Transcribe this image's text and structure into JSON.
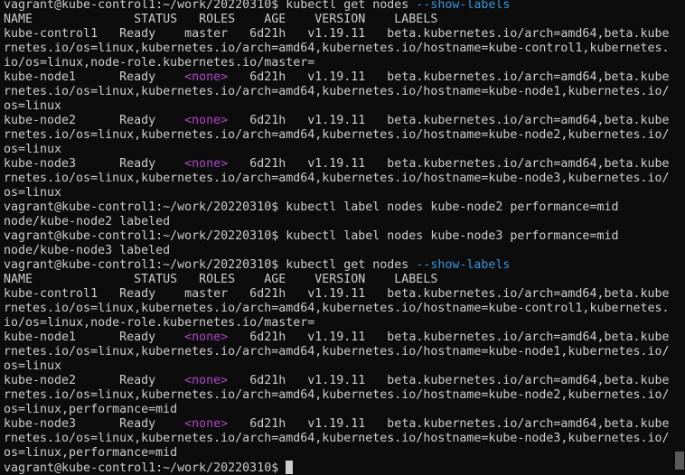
{
  "terminal": {
    "lines": [
      [
        {
          "t": "vagrant@kube-control1:~/work/20220310$ kubectl get nodes "
        },
        {
          "t": "--show-labels",
          "c": "flag"
        }
      ],
      [
        {
          "t": "NAME              STATUS   ROLES    AGE    VERSION    LABELS"
        }
      ],
      [
        {
          "t": "kube-control1   Ready    master   6d21h   v1.19.11   beta.kubernetes.io/arch=amd64,beta.kube"
        }
      ],
      [
        {
          "t": "rnetes.io/os=linux,kubernetes.io/arch=amd64,kubernetes.io/hostname=kube-control1,kubernetes."
        }
      ],
      [
        {
          "t": "io/os=linux,node-role.kubernetes.io/master="
        }
      ],
      [
        {
          "t": "kube-node1      Ready    "
        },
        {
          "t": "<none>",
          "c": "none"
        },
        {
          "t": "   6d21h   v1.19.11   beta.kubernetes.io/arch=amd64,beta.kube"
        }
      ],
      [
        {
          "t": "rnetes.io/os=linux,kubernetes.io/arch=amd64,kubernetes.io/hostname=kube-node1,kubernetes.io/"
        }
      ],
      [
        {
          "t": "os=linux"
        }
      ],
      [
        {
          "t": "kube-node2      Ready    "
        },
        {
          "t": "<none>",
          "c": "none"
        },
        {
          "t": "   6d21h   v1.19.11   beta.kubernetes.io/arch=amd64,beta.kube"
        }
      ],
      [
        {
          "t": "rnetes.io/os=linux,kubernetes.io/arch=amd64,kubernetes.io/hostname=kube-node2,kubernetes.io/"
        }
      ],
      [
        {
          "t": "os=linux"
        }
      ],
      [
        {
          "t": "kube-node3      Ready    "
        },
        {
          "t": "<none>",
          "c": "none"
        },
        {
          "t": "   6d21h   v1.19.11   beta.kubernetes.io/arch=amd64,beta.kube"
        }
      ],
      [
        {
          "t": "rnetes.io/os=linux,kubernetes.io/arch=amd64,kubernetes.io/hostname=kube-node3,kubernetes.io/"
        }
      ],
      [
        {
          "t": "os=linux"
        }
      ],
      [
        {
          "t": "vagrant@kube-control1:~/work/20220310$ kubectl label nodes kube-node2 performance=mid"
        }
      ],
      [
        {
          "t": "node/kube-node2 labeled"
        }
      ],
      [
        {
          "t": "vagrant@kube-control1:~/work/20220310$ kubectl label nodes kube-node3 performance=mid"
        }
      ],
      [
        {
          "t": "node/kube-node3 labeled"
        }
      ],
      [
        {
          "t": "vagrant@kube-control1:~/work/20220310$ kubectl get nodes "
        },
        {
          "t": "--show-labels",
          "c": "flag"
        }
      ],
      [
        {
          "t": "NAME              STATUS   ROLES    AGE    VERSION    LABELS"
        }
      ],
      [
        {
          "t": "kube-control1   Ready    master   6d21h   v1.19.11   beta.kubernetes.io/arch=amd64,beta.kube"
        }
      ],
      [
        {
          "t": "rnetes.io/os=linux,kubernetes.io/arch=amd64,kubernetes.io/hostname=kube-control1,kubernetes."
        }
      ],
      [
        {
          "t": "io/os=linux,node-role.kubernetes.io/master="
        }
      ],
      [
        {
          "t": "kube-node1      Ready    "
        },
        {
          "t": "<none>",
          "c": "none"
        },
        {
          "t": "   6d21h   v1.19.11   beta.kubernetes.io/arch=amd64,beta.kube"
        }
      ],
      [
        {
          "t": "rnetes.io/os=linux,kubernetes.io/arch=amd64,kubernetes.io/hostname=kube-node1,kubernetes.io/"
        }
      ],
      [
        {
          "t": "os=linux"
        }
      ],
      [
        {
          "t": "kube-node2      Ready    "
        },
        {
          "t": "<none>",
          "c": "none"
        },
        {
          "t": "   6d21h   v1.19.11   beta.kubernetes.io/arch=amd64,beta.kube"
        }
      ],
      [
        {
          "t": "rnetes.io/os=linux,kubernetes.io/arch=amd64,kubernetes.io/hostname=kube-node2,kubernetes.io/"
        }
      ],
      [
        {
          "t": "os=linux,performance=mid"
        }
      ],
      [
        {
          "t": "kube-node3      Ready    "
        },
        {
          "t": "<none>",
          "c": "none"
        },
        {
          "t": "   6d21h   v1.19.11   beta.kubernetes.io/arch=amd64,beta.kube"
        }
      ],
      [
        {
          "t": "rnetes.io/os=linux,kubernetes.io/arch=amd64,kubernetes.io/hostname=kube-node3,kubernetes.io/"
        }
      ],
      [
        {
          "t": "os=linux,performance=mid"
        }
      ]
    ],
    "prompt": "vagrant@kube-control1:~/work/20220310$ ",
    "colors": {
      "background": "#0c0c0c",
      "foreground": "#cccccc",
      "flag": "#3a96dd",
      "none": "#b148c6"
    }
  }
}
